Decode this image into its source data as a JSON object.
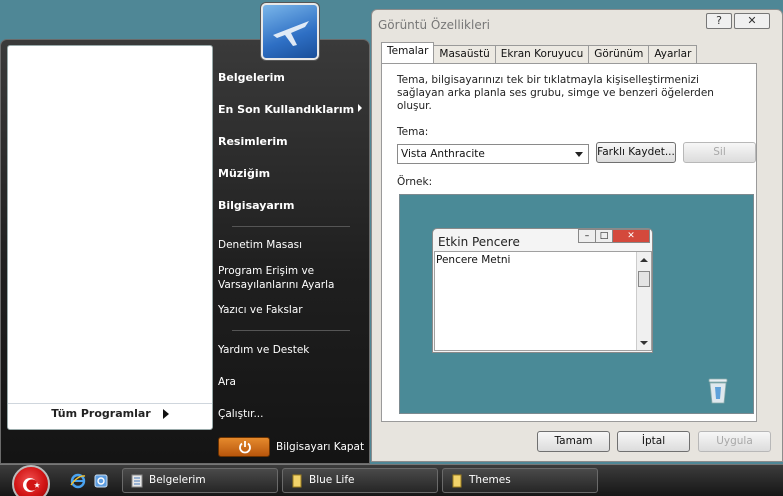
{
  "start_menu": {
    "all_programs": "Tüm Programlar",
    "items_bold": [
      "Belgelerim",
      "En Son Kullandıklarım",
      "Resimlerim",
      "Müziğim",
      "Bilgisayarım"
    ],
    "items_thin": [
      "Denetim Masası",
      "Program Erişim ve",
      "Varsayılanlarını Ayarla",
      "Yazıcı ve Fakslar",
      "Yardım ve Destek",
      "Ara",
      "Çalıştır..."
    ],
    "shutdown": "Bilgisayarı Kapat"
  },
  "dialog": {
    "title": "Görüntü Özellikleri",
    "help": "?",
    "close": "✕",
    "tabs": [
      "Temalar",
      "Masaüstü",
      "Ekran Koruyucu",
      "Görünüm",
      "Ayarlar"
    ],
    "description": "Tema, bilgisayarınızı tek bir tıklatmayla kişiselleştirmenizi sağlayan arka planla ses grubu, simge ve benzeri öğelerden oluşur.",
    "theme_label": "Tema:",
    "theme_value": "Vista Anthracite",
    "save_as": "Farklı Kaydet...",
    "delete": "Sil",
    "sample_label": "Örnek:",
    "preview": {
      "window_title": "Etkin Pencere",
      "window_text": "Pencere Metni"
    },
    "ok": "Tamam",
    "cancel": "İptal",
    "apply": "Uygula"
  },
  "taskbar": {
    "buttons": [
      "Belgelerim",
      "Blue Life",
      "Themes"
    ]
  }
}
